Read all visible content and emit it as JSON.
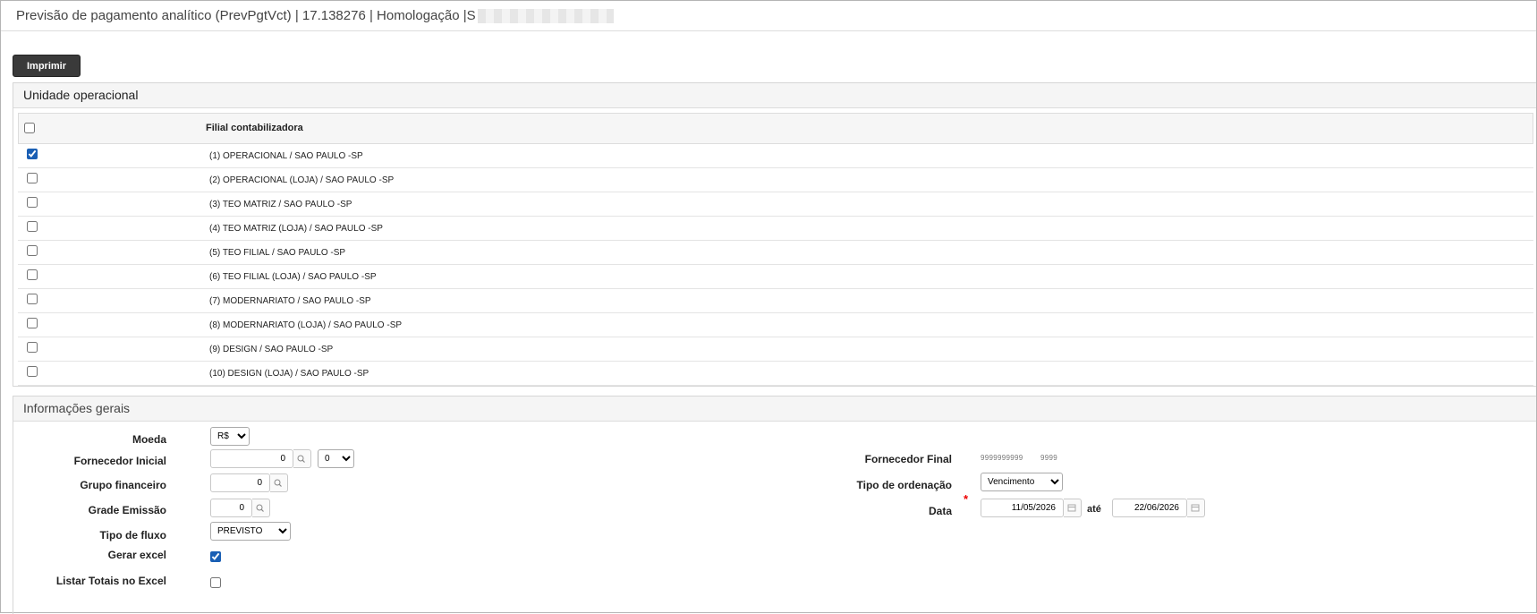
{
  "window": {
    "title_text": "Previsão de pagamento analítico (PrevPgtVct) | 17.138276 | Homologação | ",
    "title_tail": "S"
  },
  "toolbar": {
    "print_label": "Imprimir"
  },
  "unit_panel": {
    "title": "Unidade operacional",
    "column_header": "Filial contabilizadora",
    "rows": [
      {
        "label": "(1) OPERACIONAL / SAO PAULO -SP",
        "checked": true
      },
      {
        "label": "(2) OPERACIONAL (LOJA) / SAO PAULO -SP",
        "checked": false
      },
      {
        "label": "(3) TEO MATRIZ / SAO PAULO -SP",
        "checked": false
      },
      {
        "label": "(4) TEO MATRIZ (LOJA) / SAO PAULO -SP",
        "checked": false
      },
      {
        "label": "(5) TEO FILIAL / SAO PAULO -SP",
        "checked": false
      },
      {
        "label": "(6) TEO FILIAL (LOJA) / SAO PAULO -SP",
        "checked": false
      },
      {
        "label": "(7) MODERNARIATO / SAO PAULO -SP",
        "checked": false
      },
      {
        "label": "(8) MODERNARIATO (LOJA) / SAO PAULO -SP",
        "checked": false
      },
      {
        "label": "(9) DESIGN / SAO PAULO -SP",
        "checked": false
      },
      {
        "label": "(10) DESIGN (LOJA) / SAO PAULO -SP",
        "checked": false
      }
    ]
  },
  "info_panel": {
    "title": "Informações gerais",
    "moeda": {
      "label": "Moeda",
      "value": "R$"
    },
    "fornecedor_inicial": {
      "label": "Fornecedor Inicial",
      "value": "0",
      "select_value": "0"
    },
    "grupo_financeiro": {
      "label": "Grupo financeiro",
      "value": "0"
    },
    "grade_emissao": {
      "label": "Grade Emissão",
      "value": "0"
    },
    "tipo_fluxo": {
      "label": "Tipo de fluxo",
      "value": "PREVISTO"
    },
    "gerar_excel": {
      "label": "Gerar excel",
      "checked": true
    },
    "listar_totais": {
      "label": "Listar Totais no Excel",
      "checked": false
    },
    "fornecedor_final": {
      "label": "Fornecedor Final",
      "value": "9999999999",
      "value2": "9999"
    },
    "tipo_ordenacao": {
      "label": "Tipo de ordenação",
      "value": "Vencimento"
    },
    "data": {
      "label": "Data",
      "required_mark": "*",
      "from": "11/05/2026",
      "between": "até",
      "to": "22/06/2026"
    }
  }
}
